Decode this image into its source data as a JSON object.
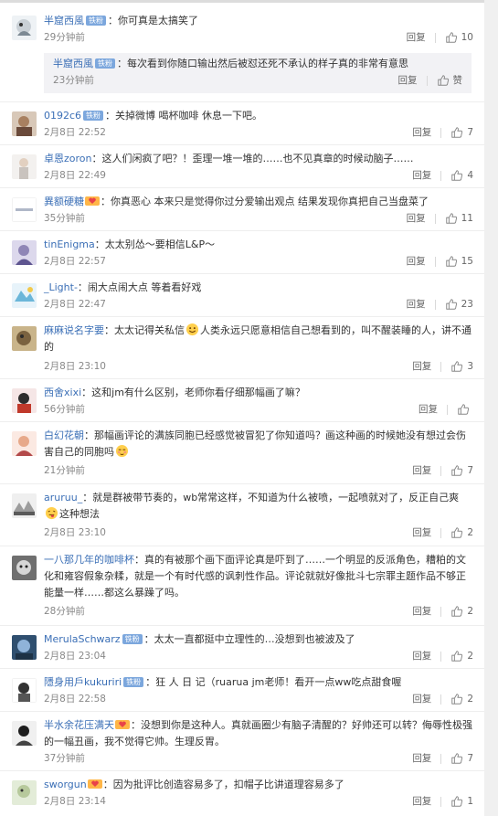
{
  "badges": {
    "iron_fan": "铁粉"
  },
  "actions": {
    "reply": "回复",
    "like_word": "赞"
  },
  "colors": {
    "username": "#3b6fb6",
    "badge_bg": "#7ca7dd",
    "subreply_bg": "#f2f2f5"
  },
  "comments": [
    {
      "user": "半窟西風",
      "fan": "iron",
      "text": "：你可真是太搞笑了",
      "time": "29分钟前",
      "likes": "10"
    },
    {
      "user": "0192c6",
      "fan": "iron",
      "text": "：关掉微博 喝杯咖啡 休息一下吧。",
      "time": "2月8日 22:52",
      "likes": "7"
    },
    {
      "user": "卓恩zoron",
      "text": "：这人们闲疯了吧？！歪理一堆一堆的……也不见真章的时候动脑子……",
      "time": "2月8日 22:49",
      "likes": "4"
    },
    {
      "user": "異额硬糖",
      "fan": "heart",
      "text": "：你真恶心 本来只是觉得你过分爱输出观点 结果发现你真把自己当盘菜了",
      "time": "35分钟前",
      "likes": "11"
    },
    {
      "user": "tinEnigma",
      "text": "：太太别怂～要相信L&P～",
      "time": "2月8日 22:57",
      "likes": "15"
    },
    {
      "user": "_Light-",
      "text": "：闹大点闹大点 等着看好戏",
      "time": "2月8日 22:47",
      "likes": "23"
    },
    {
      "user": "麻麻说名字要",
      "text_a": "：太太记得关私信",
      "text_b": "人类永远只愿意相信自己想看到的，叫不醒装睡的人，讲不通的",
      "time": "2月8日 23:10",
      "likes": "3"
    },
    {
      "user": "西舍xixi",
      "text": "：这和jm有什么区别，老师你看仔细那幅画了嘛？",
      "time": "56分钟前",
      "likes": ""
    },
    {
      "user": "白幻花朝",
      "text": "：那幅画评论的满族同胞已经感觉被冒犯了你知道吗？画这种画的时候她没有想过会伤害自己的同胞吗",
      "time": "21分钟前",
      "likes": "7"
    },
    {
      "user": "aruruu_",
      "text": "：就是群被带节奏的，wb常常这样，不知道为什么被喷，一起喷就对了，反正自己爽",
      "text_b": "这种想法",
      "time": "2月8日 23:10",
      "likes": "2"
    },
    {
      "user": "一八那几年的咖啡杯",
      "text": "：真的有被那个画下面评论真是吓到了……一个明显的反派角色，糟粕的文化和雍容假象杂糅，就是一个有时代感的讽刺性作品。评论就就好像批斗七宗罪主题作品不够正能量一样……都这么暴躁了吗。",
      "time": "28分钟前",
      "likes": "2"
    },
    {
      "user": "MerulaSchwarz",
      "fan": "iron",
      "text": "：太太一直都挺中立理性的…没想到也被波及了",
      "time": "2月8日 23:04",
      "likes": "2"
    },
    {
      "user": "隱身用戶kukuriri",
      "fan": "iron",
      "text": "：狂 人 日 记（ruarua jm老师！看开一点ww吃点甜食喔",
      "time": "2月8日 22:58",
      "likes": "2"
    },
    {
      "user": "半水余花压满天",
      "fan": "heart",
      "text": "：没想到你是这种人。真就画圈少有脑子清醒的？好帅还可以转？侮辱性极强的一幅丑画，我不觉得它帅。生理反胃。",
      "time": "37分钟前",
      "likes": "7"
    },
    {
      "user": "sworgun",
      "fan": "heart",
      "text": "：因为批评比创造容易多了，扣帽子比讲道理容易多了",
      "time": "2月8日 23:14",
      "likes": "1"
    }
  ],
  "subreply": {
    "user": "半窟西風",
    "fan": "iron",
    "text": "：每次看到你随口输出然后被怼还死不承认的样子真的非常有意思",
    "time": "23分钟前"
  }
}
